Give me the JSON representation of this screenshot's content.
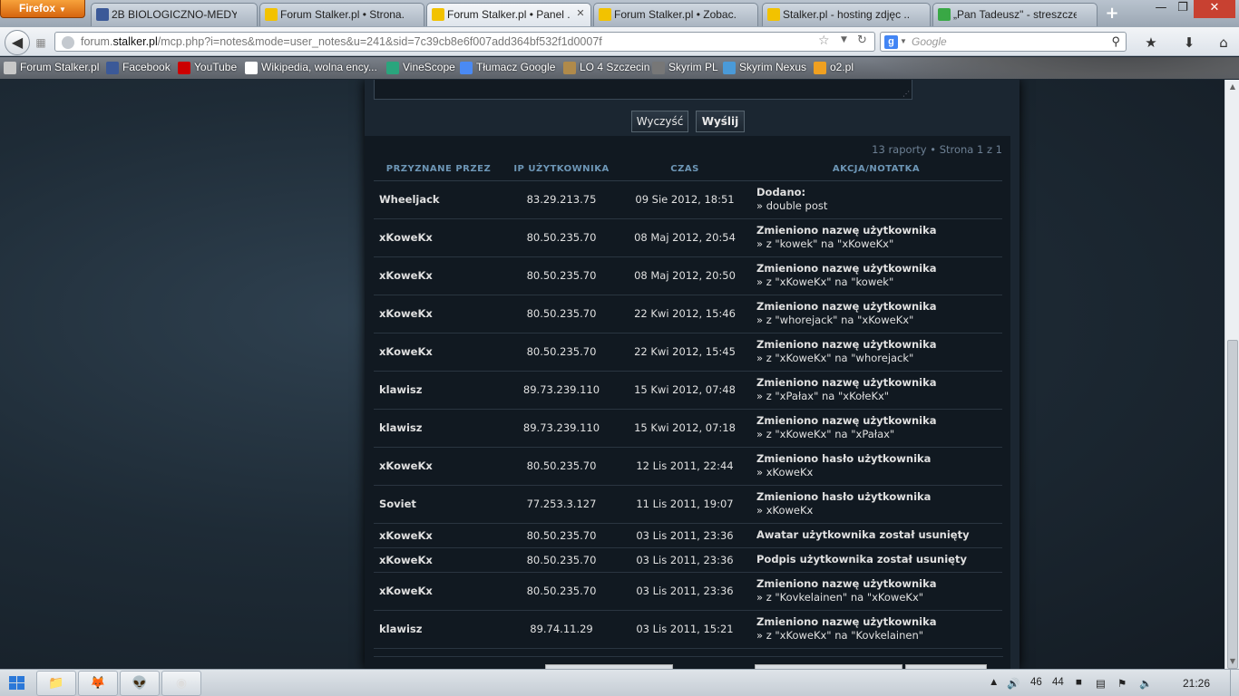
{
  "browser": {
    "menu_button": "Firefox",
    "tabs": [
      {
        "label": "2B BIOLOGICZNO-MEDY...",
        "icon": "facebook-icon",
        "active": false
      },
      {
        "label": "Forum Stalker.pl • Strona...",
        "icon": "radiation-icon",
        "active": false
      },
      {
        "label": "Forum Stalker.pl • Panel ...",
        "icon": "radiation-icon",
        "active": true
      },
      {
        "label": "Forum Stalker.pl • Zobac...",
        "icon": "radiation-icon",
        "active": false
      },
      {
        "label": "Stalker.pl - hosting zdjęc ...",
        "icon": "radiation-icon",
        "active": false
      },
      {
        "label": "„Pan Tadeusz\" - streszcze...",
        "icon": "green-swirl-icon",
        "active": false
      }
    ],
    "new_tab": "+",
    "url": {
      "prefix": "forum.",
      "host": "stalker.pl",
      "path": "/mcp.php?i=notes&mode=user_notes&u=241&sid=7c39cb8e6f007add364bf532f1d0007f"
    },
    "search_placeholder": "Google",
    "bookmarks": [
      {
        "label": "Forum Stalker.pl",
        "color": "#c8c8c8"
      },
      {
        "label": "Facebook",
        "color": "#3b5998"
      },
      {
        "label": "YouTube",
        "color": "#cc0000"
      },
      {
        "label": "Wikipedia, wolna ency...",
        "color": "#ffffff"
      },
      {
        "label": "VineScope",
        "color": "#2aa57d"
      },
      {
        "label": "Tłumacz Google",
        "color": "#4a8af4"
      },
      {
        "label": "LO 4 Szczecin",
        "color": "#b08a4a"
      },
      {
        "label": "Skyrim PL",
        "color": "#777777"
      },
      {
        "label": "Skyrim Nexus",
        "color": "#4a9ad8"
      },
      {
        "label": "o2.pl",
        "color": "#f0a020"
      }
    ]
  },
  "form": {
    "clear_button": "Wyczyść",
    "submit_button": "Wyślij"
  },
  "reports": {
    "pagination": "13 raporty • Strona 1 z 1",
    "columns": [
      "PRZYZNANE PRZEZ",
      "IP UŻYTKOWNIKA",
      "CZAS",
      "AKCJA/NOTATKA"
    ],
    "rows": [
      {
        "user": "Wheeljack",
        "user_color": "green",
        "ip": "83.29.213.75",
        "time": "09 Sie 2012, 18:51",
        "action": "Dodano:",
        "note": "» double post"
      },
      {
        "user": "xKoweKx",
        "user_color": "orange",
        "ip": "80.50.235.70",
        "time": "08 Maj 2012, 20:54",
        "action": "Zmieniono nazwę użytkownika",
        "note": "» z \"kowek\" na \"xKoweKx\""
      },
      {
        "user": "xKoweKx",
        "user_color": "orange",
        "ip": "80.50.235.70",
        "time": "08 Maj 2012, 20:50",
        "action": "Zmieniono nazwę użytkownika",
        "note": "» z \"xKoweKx\" na \"kowek\""
      },
      {
        "user": "xKoweKx",
        "user_color": "orange",
        "ip": "80.50.235.70",
        "time": "22 Kwi 2012, 15:46",
        "action": "Zmieniono nazwę użytkownika",
        "note": "» z \"whorejack\" na \"xKoweKx\""
      },
      {
        "user": "xKoweKx",
        "user_color": "orange",
        "ip": "80.50.235.70",
        "time": "22 Kwi 2012, 15:45",
        "action": "Zmieniono nazwę użytkownika",
        "note": "» z \"xKoweKx\" na \"whorejack\""
      },
      {
        "user": "klawisz",
        "user_color": "green",
        "ip": "89.73.239.110",
        "time": "15 Kwi 2012, 07:48",
        "action": "Zmieniono nazwę użytkownika",
        "note": "» z \"xPałax\" na \"xKołeKx\""
      },
      {
        "user": "klawisz",
        "user_color": "green",
        "ip": "89.73.239.110",
        "time": "15 Kwi 2012, 07:18",
        "action": "Zmieniono nazwę użytkownika",
        "note": "» z \"xKoweKx\" na \"xPałax\""
      },
      {
        "user": "xKoweKx",
        "user_color": "orange",
        "ip": "80.50.235.70",
        "time": "12 Lis 2011, 22:44",
        "action": "Zmieniono hasło użytkownika",
        "note": "» xKoweKx"
      },
      {
        "user": "Soviet",
        "user_color": "orange",
        "ip": "77.253.3.127",
        "time": "11 Lis 2011, 19:07",
        "action": "Zmieniono hasło użytkownika",
        "note": "» xKoweKx"
      },
      {
        "user": "xKoweKx",
        "user_color": "orange",
        "ip": "80.50.235.70",
        "time": "03 Lis 2011, 23:36",
        "action": "Awatar użytkownika został usunięty",
        "note": ""
      },
      {
        "user": "xKoweKx",
        "user_color": "orange",
        "ip": "80.50.235.70",
        "time": "03 Lis 2011, 23:36",
        "action": "Podpis użytkownika został usunięty",
        "note": ""
      },
      {
        "user": "xKoweKx",
        "user_color": "orange",
        "ip": "80.50.235.70",
        "time": "03 Lis 2011, 23:36",
        "action": "Zmieniono nazwę użytkownika",
        "note": "» z \"Kovkelainen\" na \"xKoweKx\""
      },
      {
        "user": "klawisz",
        "user_color": "green",
        "ip": "89.74.11.29",
        "time": "03 Lis 2011, 15:21",
        "action": "Zmieniono nazwę użytkownika",
        "note": "» z \"xKoweKx\" na \"Kovkelainen\""
      }
    ]
  },
  "taskbar": {
    "apps": [
      "explorer-icon",
      "firefox-icon",
      "alien-icon",
      "chrome-icon"
    ],
    "tray_numbers": [
      "46",
      "44"
    ],
    "clock": "21:26"
  },
  "colors": {
    "green_user": "#39c232",
    "orange_user": "#f08a2c",
    "header_text": "#6d96b6"
  }
}
